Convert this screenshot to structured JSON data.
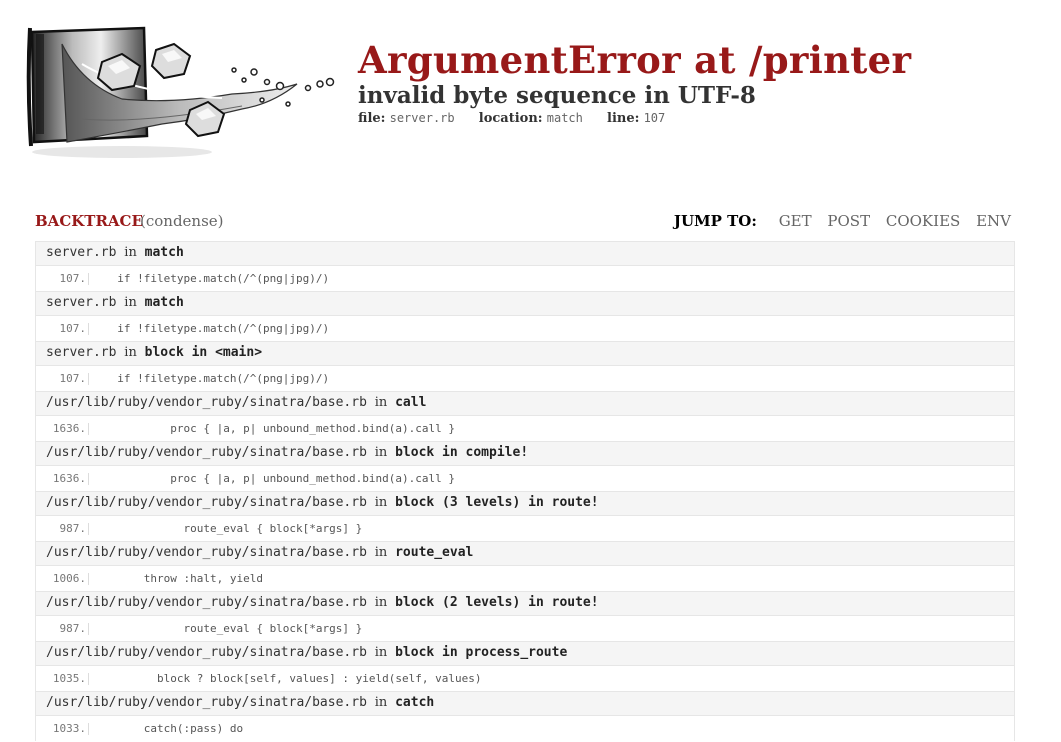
{
  "header": {
    "title": "ArgumentError at /printer",
    "subtitle": "invalid byte sequence in UTF-8",
    "file_label": "file:",
    "file_value": "server.rb",
    "location_label": "location:",
    "location_value": "match",
    "line_label": "line:",
    "line_value": "107"
  },
  "backtrace_bar": {
    "label": "BACKTRACE",
    "condense": "(condense)",
    "jump_label": "JUMP TO:",
    "jump_links": [
      "GET",
      "POST",
      "COOKIES",
      "ENV"
    ]
  },
  "frames": [
    {
      "file": "server.rb",
      "in": "in",
      "func": "match",
      "lineno": "107.",
      "code": "  if !filetype.match(/^(png|jpg)/)"
    },
    {
      "file": "server.rb",
      "in": "in",
      "func": "match",
      "lineno": "107.",
      "code": "  if !filetype.match(/^(png|jpg)/)"
    },
    {
      "file": "server.rb",
      "in": "in",
      "func": "block in <main>",
      "lineno": "107.",
      "code": "  if !filetype.match(/^(png|jpg)/)"
    },
    {
      "file": "/usr/lib/ruby/vendor_ruby/sinatra/base.rb",
      "in": "in",
      "func": "call",
      "lineno": "1636.",
      "code": "          proc { |a, p| unbound_method.bind(a).call }"
    },
    {
      "file": "/usr/lib/ruby/vendor_ruby/sinatra/base.rb",
      "in": "in",
      "func": "block in compile!",
      "lineno": "1636.",
      "code": "          proc { |a, p| unbound_method.bind(a).call }"
    },
    {
      "file": "/usr/lib/ruby/vendor_ruby/sinatra/base.rb",
      "in": "in",
      "func": "block (3 levels) in route!",
      "lineno": "987.",
      "code": "            route_eval { block[*args] }"
    },
    {
      "file": "/usr/lib/ruby/vendor_ruby/sinatra/base.rb",
      "in": "in",
      "func": "route_eval",
      "lineno": "1006.",
      "code": "      throw :halt, yield"
    },
    {
      "file": "/usr/lib/ruby/vendor_ruby/sinatra/base.rb",
      "in": "in",
      "func": "block (2 levels) in route!",
      "lineno": "987.",
      "code": "            route_eval { block[*args] }"
    },
    {
      "file": "/usr/lib/ruby/vendor_ruby/sinatra/base.rb",
      "in": "in",
      "func": "block in process_route",
      "lineno": "1035.",
      "code": "        block ? block[self, values] : yield(self, values)"
    },
    {
      "file": "/usr/lib/ruby/vendor_ruby/sinatra/base.rb",
      "in": "in",
      "func": "catch",
      "lineno": "1033.",
      "code": "      catch(:pass) do"
    }
  ],
  "colors": {
    "title": "#981919",
    "row_background": "#f5f5f5",
    "border": "#e6e6e6"
  },
  "icons": {
    "logo": "glass-with-ice-cubes-splash-logo"
  }
}
